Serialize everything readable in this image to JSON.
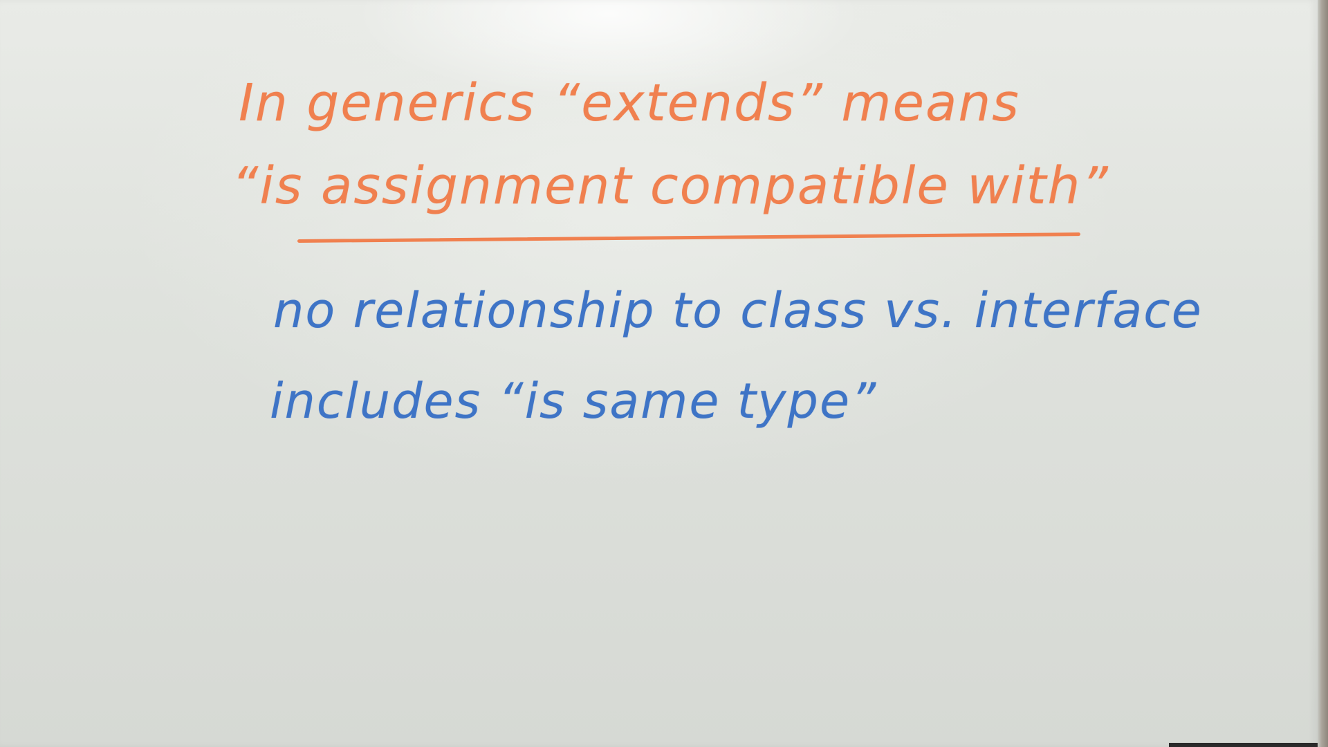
{
  "whiteboard": {
    "lines": [
      {
        "text": "In generics “extends” means"
      },
      {
        "text": "“is assignment compatible with”"
      },
      {
        "text": "no relationship to class vs. interface"
      },
      {
        "text": "includes “is same type”"
      }
    ],
    "colors": {
      "orange_marker": "#f0804f",
      "blue_marker": "#3e74c6",
      "board": "#e3e6e1"
    }
  }
}
